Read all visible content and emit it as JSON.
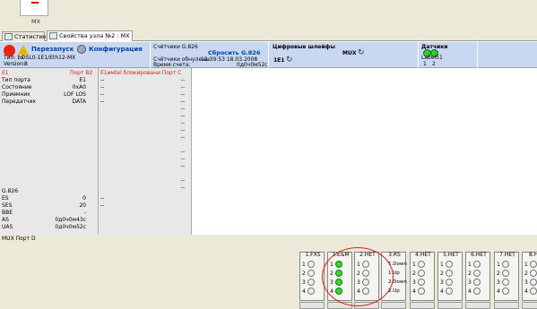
{
  "titlebar": {
    "node_caption": "MX"
  },
  "tabs": [
    {
      "label": "Статистика"
    },
    {
      "label": "Свойства узла №2 : MX"
    }
  ],
  "header": {
    "restart_label": "Перезапуск",
    "config_label": "Конфигурация",
    "type_label": "Тип: bs",
    "type_value": "DSL0-1E1/Eth12-MX",
    "version_label": "Version:",
    "version_value": "8",
    "counters_title": "Счётчики G.826",
    "reset_label": "Сбросить G.826",
    "reset_time_label": "Счётчики обнулены:",
    "reset_time_value": "12:39:53 18.03.2008",
    "count_time_label": "Время счета:",
    "count_time_value": "0д0ч0м52с",
    "digital_title": "Цифровые шлейфы",
    "digital_e1": "1E1",
    "digital_mux": "MUX",
    "sensors_title": "Датчики",
    "sensors_label": "Label51",
    "sensor_1": "1",
    "sensor_2": "2"
  },
  "left": {
    "e1_label": "E1",
    "e1_port": "Порт В2",
    "rows": [
      {
        "k": "Тип порта",
        "v": "E1"
      },
      {
        "k": "Состояние",
        "v": "0xA0"
      },
      {
        "k": "Приемник",
        "v": "LOF LOS"
      },
      {
        "k": "Передатчик",
        "v": "DATA"
      }
    ],
    "g826_title": "G.826",
    "g826_rows": [
      {
        "k": "ES",
        "v": "0"
      },
      {
        "k": "SES",
        "v": "20"
      },
      {
        "k": "BBE",
        "v": "-"
      },
      {
        "k": "AS",
        "v": "0д0ч0м43с"
      },
      {
        "k": "UAS",
        "v": "0д0ч0м52с"
      }
    ]
  },
  "mid": {
    "header_a": "Е1имtel блокировани",
    "header_b": "Порт С",
    "dash": "--"
  },
  "bottom": {
    "mux_label": "MUX Порт D",
    "ports": [
      {
        "label": "1.FXS",
        "leds": [
          {
            "n": "1",
            "g": false
          },
          {
            "n": "2",
            "g": false
          },
          {
            "n": "3",
            "g": false
          },
          {
            "n": "4",
            "g": false
          }
        ]
      },
      {
        "label": "1.E&M",
        "leds": [
          {
            "n": "1",
            "g": true
          },
          {
            "n": "2",
            "g": true
          },
          {
            "n": "3",
            "g": true
          },
          {
            "n": "4",
            "g": true
          }
        ]
      },
      {
        "label": "2.НЕТ",
        "leds": [
          {
            "n": "1",
            "g": false
          },
          {
            "n": "2",
            "g": false
          },
          {
            "n": "3",
            "g": false
          },
          {
            "n": "4",
            "g": false
          }
        ]
      },
      {
        "label": "3.RS",
        "leds": [
          {
            "t": "1.Down"
          },
          {
            "t": "1.Up"
          },
          {
            "t": "2.Down"
          },
          {
            "t": "2.Up"
          }
        ]
      },
      {
        "label": "4.НЕТ",
        "leds": [
          {
            "n": "1",
            "g": false
          },
          {
            "n": "2",
            "g": false
          },
          {
            "n": "3",
            "g": false
          },
          {
            "n": "4",
            "g": false
          }
        ]
      },
      {
        "label": "5.НЕТ",
        "leds": [
          {
            "n": "1",
            "g": false
          },
          {
            "n": "2",
            "g": false
          },
          {
            "n": "3",
            "g": false
          },
          {
            "n": "4",
            "g": false
          }
        ]
      },
      {
        "label": "6.НЕТ",
        "leds": [
          {
            "n": "1",
            "g": false
          },
          {
            "n": "2",
            "g": false
          },
          {
            "n": "3",
            "g": false
          },
          {
            "n": "4",
            "g": false
          }
        ]
      },
      {
        "label": "7.НЕТ",
        "leds": [
          {
            "n": "1",
            "g": false
          },
          {
            "n": "2",
            "g": false
          },
          {
            "n": "3",
            "g": false
          },
          {
            "n": "4",
            "g": false
          }
        ]
      },
      {
        "label": "8.НЕ",
        "leds": [
          {
            "n": "1",
            "g": false
          },
          {
            "n": "2",
            "g": false
          },
          {
            "n": "3",
            "g": false
          },
          {
            "n": "4",
            "g": false
          }
        ]
      }
    ]
  },
  "colors": {
    "header_bg": "#c9d7f0",
    "led_on": "#2ddc2d",
    "alert": "#d22"
  }
}
